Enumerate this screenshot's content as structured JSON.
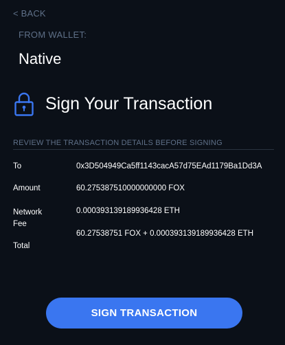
{
  "nav": {
    "back_label": "< BACK"
  },
  "wallet": {
    "from_label": "FROM WALLET:",
    "name": "Native"
  },
  "header": {
    "icon": "lock-icon",
    "title": "Sign Your Transaction"
  },
  "review": {
    "heading": "REVIEW THE TRANSACTION DETAILS BEFORE SIGNING",
    "to_label": "To",
    "to_value": "0x3D504949Ca5ff1143cacA57d75EAd1179Ba1Dd3A",
    "amount_label": "Amount",
    "amount_value": "60.275387510000000000 FOX",
    "fee_label": "Network Fee",
    "fee_value": "0.000393139189936428 ETH",
    "total_label": "Total",
    "total_value": "60.27538751 FOX + 0.000393139189936428 ETH"
  },
  "actions": {
    "sign_label": "SIGN TRANSACTION"
  },
  "colors": {
    "background": "#0b1018",
    "accent": "#3a76f0",
    "muted_text": "#5f7088",
    "divider": "#2a3340"
  }
}
